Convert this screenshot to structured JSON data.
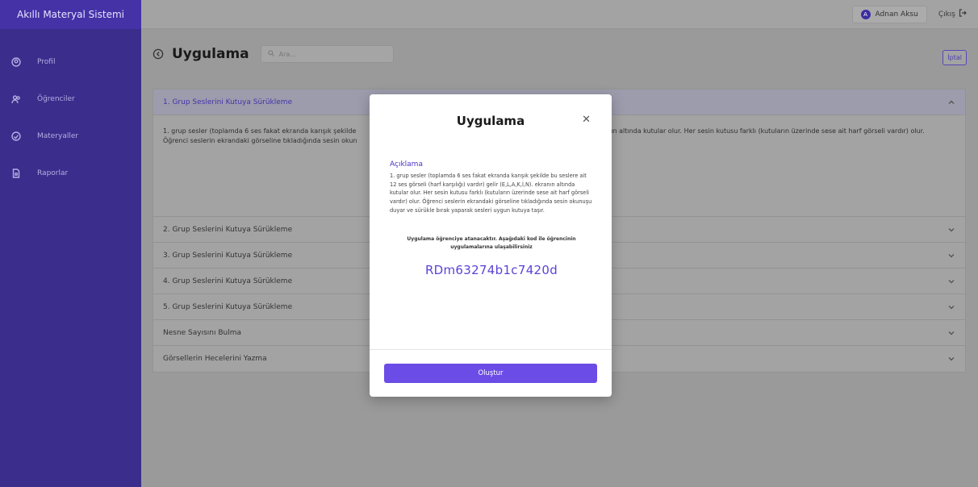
{
  "app": {
    "brand": "Akıllı Materyal Sistemi"
  },
  "sidebar": {
    "items": [
      {
        "label": "Profil",
        "icon": "profile-icon"
      },
      {
        "label": "Öğrenciler",
        "icon": "users-icon"
      },
      {
        "label": "Materyaller",
        "icon": "materials-icon"
      },
      {
        "label": "Raporlar",
        "icon": "report-icon"
      }
    ]
  },
  "topbar": {
    "avatar_letter": "A",
    "user_name": "Adnan Aksu",
    "logout_label": "Çıkış"
  },
  "page": {
    "title": "Uygulama",
    "search_placeholder": "Ara...",
    "cancel_label": "İptal"
  },
  "accordion": {
    "items": [
      {
        "label": "1. Grup Seslerini Kutuya Sürükleme",
        "open": true
      },
      {
        "label": "2. Grup Seslerini Kutuya Sürükleme"
      },
      {
        "label": "3. Grup Seslerini Kutuya Sürükleme"
      },
      {
        "label": "4. Grup Seslerini Kutuya Sürükleme"
      },
      {
        "label": "5. Grup Seslerini Kutuya Sürükleme"
      },
      {
        "label": "Nesne Sayısını Bulma"
      },
      {
        "label": "Görsellerin Hecelerini Yazma"
      }
    ],
    "open_body_left": "1. grup sesler (toplamda 6 ses fakat ekranda karışık şekilde",
    "open_body_left_2": "Öğrenci seslerin ekrandaki görseline tıkladığında sesin okun",
    "open_body_right": "ranın altında kutular olur. Her sesin kutusu farklı (kutuların üzerinde sese ait harf görseli vardır) olur."
  },
  "modal": {
    "title": "Uygulama",
    "section_title": "Açıklama",
    "description": "1. grup sesler (toplamda 6 ses fakat ekranda karışık şekilde bu seslere ait 12 ses görseli (harf karşılığı) vardır) gelir (E,L,A,K,İ,N). ekranın altında kutular olur. Her sesin kutusu farklı (kutuların üzerinde sese ait harf görseli vardır) olur. Öğrenci seslerin ekrandaki görseline tıkladığında sesin okunuşu duyar ve sürükle bırak yaparak sesleri uygun kutuya taşır.",
    "note": "Uygulama öğrenciye atanacaktır. Aşağıdaki kod ile öğrencinin uygulamalarına ulaşabilirsiniz",
    "code": "RDm63274b1c7420d",
    "submit_label": "Oluştur"
  }
}
